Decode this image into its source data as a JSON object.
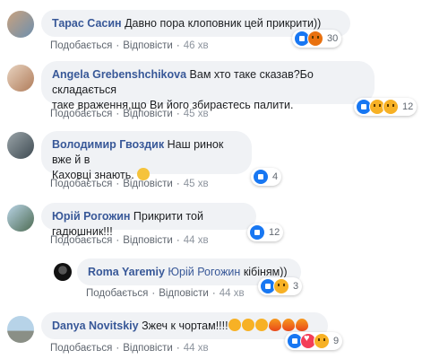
{
  "comments": [
    {
      "author": "Тарас Сасин",
      "text": "Давно пора клоповник цей прикрити))",
      "like": "Подобається",
      "reply": "Відповісти",
      "time": "46 хв",
      "reaction_count": "30",
      "reactions": [
        "like",
        "angry"
      ]
    },
    {
      "author": "Angela Grebenshchikova",
      "text_line1": "Вам хто таке сказав?Бо складається",
      "text_line2": "таке враження,що Ви його збираєтесь палити.",
      "like": "Подобається",
      "reply": "Відповісти",
      "time": "45 хв",
      "reaction_count": "12",
      "reactions": [
        "like",
        "haha",
        "wow"
      ]
    },
    {
      "author": "Володимир Гвоздик",
      "text_line1": "Наш ринок вже й в",
      "text_line2": "Каховці знають.",
      "inline_emoji": "clapping-hands",
      "like": "Подобається",
      "reply": "Відповісти",
      "time": "45 хв",
      "reaction_count": "4",
      "reactions": [
        "like"
      ]
    },
    {
      "author": "Юрій Рогожин",
      "text": "Прикрити той гадюшник!!!",
      "like": "Подобається",
      "reply": "Відповісти",
      "time": "44 хв",
      "reaction_count": "12",
      "reactions": [
        "like"
      ]
    },
    {
      "author": "Roma Yaremiy",
      "mention": "Юрій Рогожин",
      "text": "кібіням))",
      "like": "Подобається",
      "reply": "Відповісти",
      "time": "44 хв",
      "reaction_count": "3",
      "reactions": [
        "like",
        "haha"
      ]
    },
    {
      "author": "Danya Novitskiy",
      "text": "Зжеч к чортам!!!!",
      "inline_emojis": [
        "laughing",
        "laughing",
        "laughing",
        "fire",
        "fire",
        "fire"
      ],
      "like": "Подобається",
      "reply": "Відповісти",
      "time": "44 хв",
      "reaction_count": "9",
      "reactions": [
        "like",
        "love",
        "haha"
      ]
    }
  ],
  "colors": {
    "author": "#385898",
    "bubble": "#f0f2f5",
    "meta": "#606770",
    "like_blue": "#1877f2"
  }
}
